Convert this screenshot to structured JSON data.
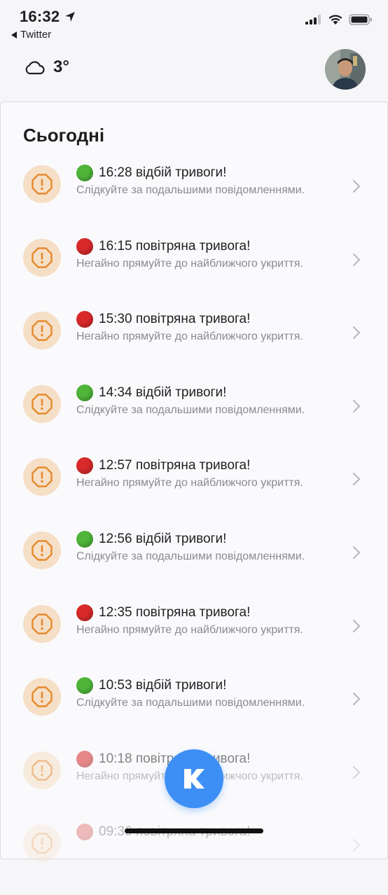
{
  "status_bar": {
    "time": "16:32",
    "back_app": "Twitter"
  },
  "header": {
    "weather_icon": "cloud-icon",
    "temperature": "3°"
  },
  "section": {
    "title": "Сьогодні"
  },
  "alerts": [
    {
      "status": "green",
      "title": "16:28 відбій тривоги!",
      "subtitle": "Слідкуйте за подальшими повідомленнями."
    },
    {
      "status": "red",
      "title": "16:15 повітряна тривога!",
      "subtitle": "Негайно прямуйте до найближчого укриття."
    },
    {
      "status": "red",
      "title": "15:30 повітряна тривога!",
      "subtitle": "Негайно прямуйте до найближчого укриття."
    },
    {
      "status": "green",
      "title": "14:34 відбій тривоги!",
      "subtitle": "Слідкуйте за подальшими повідомленнями."
    },
    {
      "status": "red",
      "title": "12:57 повітряна тривога!",
      "subtitle": "Негайно прямуйте до найближчого укриття."
    },
    {
      "status": "green",
      "title": "12:56 відбій тривоги!",
      "subtitle": "Слідкуйте за подальшими повідомленнями."
    },
    {
      "status": "red",
      "title": "12:35 повітряна тривога!",
      "subtitle": "Негайно прямуйте до найближчого укриття."
    },
    {
      "status": "green",
      "title": "10:53 відбій тривоги!",
      "subtitle": "Слідкуйте за подальшими повідомленнями."
    },
    {
      "status": "red",
      "title": "10:18 повітряна тривога!",
      "subtitle": "Негайно прямуйте до найближчого укриття."
    },
    {
      "status": "red",
      "title": "09:36 повітряна тривога!",
      "subtitle": ""
    }
  ],
  "colors": {
    "accent": "#3d8ff5",
    "alert_badge_bg": "#f6dfc7",
    "alert_icon": "#e58a2e",
    "status_green": "#4fb63a",
    "status_red": "#d82a2a"
  },
  "fab": {
    "icon": "k-logo-icon"
  }
}
